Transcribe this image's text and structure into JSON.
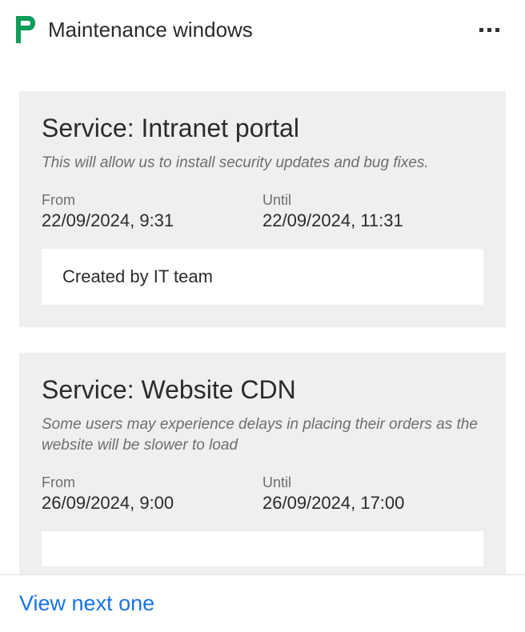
{
  "header": {
    "title": "Maintenance windows"
  },
  "cards": [
    {
      "title": "Service: Intranet portal",
      "description": "This will allow us to install security updates and bug fixes.",
      "from_label": "From",
      "from_value": "22/09/2024, 9:31",
      "until_label": "Until",
      "until_value": "22/09/2024, 11:31",
      "created_by": "Created by IT team"
    },
    {
      "title": "Service: Website CDN",
      "description": "Some users may experience delays in placing their orders as the website will be slower to load",
      "from_label": "From",
      "from_value": "26/09/2024, 9:00",
      "until_label": "Until",
      "until_value": "26/09/2024, 17:00",
      "created_by": ""
    }
  ],
  "footer": {
    "link_text": "View next one"
  }
}
